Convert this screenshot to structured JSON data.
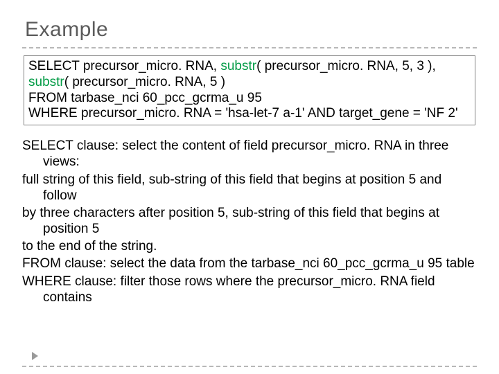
{
  "title": "Example",
  "sql": {
    "select_kw": "SELECT",
    "select_a": " precursor_micro. RNA, ",
    "substr_kw1": "substr",
    "select_b": "( precursor_micro. RNA, 5, 3 ),",
    "substr_kw2": "substr",
    "select_c": "( precursor_micro. RNA, 5 )",
    "from_kw": "FROM",
    "from_rest": " tarbase_nci 60_pcc_gcrma_u 95",
    "where_kw": "WHERE",
    "where_rest": " precursor_micro. RNA = 'hsa-let-7 a-1'  AND target_gene = 'NF 2'"
  },
  "body": {
    "p1": "SELECT clause: select the content of field precursor_micro. RNA in three views:",
    "p2": "full string of this field, sub-string of this field that begins at position 5 and follow",
    "p3": "by three characters after position 5, sub-string of this field that begins at position 5",
    "p4": "to the end of the string.",
    "p5": "FROM clause: select the data from the tarbase_nci 60_pcc_gcrma_u 95 table",
    "p6": "WHERE clause: filter those rows where the precursor_micro. RNA field contains"
  }
}
